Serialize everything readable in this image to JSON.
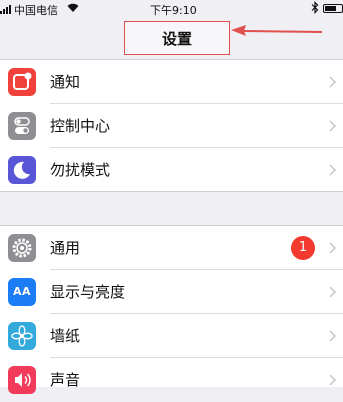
{
  "status_bar": {
    "carrier": "中国电信",
    "time": "下午9:10"
  },
  "nav": {
    "title": "设置"
  },
  "groups": [
    {
      "items": [
        {
          "label": "通知",
          "icon": "notifications-icon",
          "color": "#f0413b"
        },
        {
          "label": "控制中心",
          "icon": "control-center-icon",
          "color": "#8e8e93"
        },
        {
          "label": "勿扰模式",
          "icon": "moon-icon",
          "color": "#5856d6"
        }
      ]
    },
    {
      "items": [
        {
          "label": "通用",
          "icon": "gear-icon",
          "color": "#8e8e93",
          "badge": "1"
        },
        {
          "label": "显示与亮度",
          "icon": "display-brightness-icon",
          "color": "#1a7df5",
          "icon_text": "AA"
        },
        {
          "label": "墙纸",
          "icon": "wallpaper-flower-icon",
          "color": "#34aadc"
        },
        {
          "label": "声音",
          "icon": "speaker-icon",
          "color": "#f23a5a"
        }
      ]
    }
  ],
  "annotation_color": "#e0504e"
}
